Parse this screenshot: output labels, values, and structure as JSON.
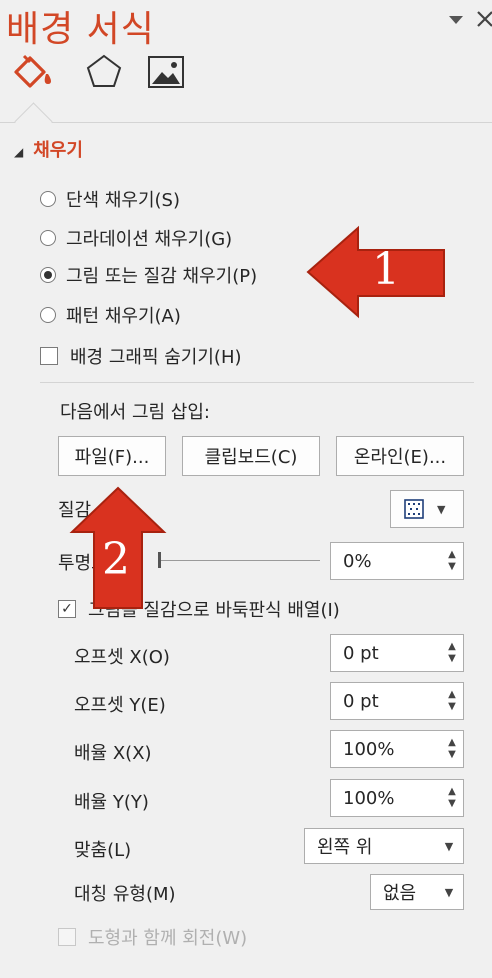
{
  "pane": {
    "title": "배경 서식",
    "options_icon": "pane-options-chevron",
    "close_icon": "close-x",
    "tabs": [
      {
        "icon": "paint-bucket-icon",
        "selected": true
      },
      {
        "icon": "pentagon-icon",
        "selected": false
      },
      {
        "icon": "picture-icon",
        "selected": false
      }
    ]
  },
  "fill": {
    "header": "채우기",
    "options": {
      "solid": "단색 채우기(S)",
      "gradient": "그라데이션 채우기(G)",
      "picture": "그림 또는 질감 채우기(P)",
      "pattern": "패턴 채우기(A)"
    },
    "selected": "picture",
    "hide_bg": "배경 그래픽 숨기기(H)",
    "insert_from": "다음에서 그림 삽입:",
    "buttons": {
      "file": "파일(F)...",
      "clipboard": "클립보드(C)",
      "online": "온라인(E)..."
    },
    "texture_label": "질감",
    "transparency_label": "투명도",
    "transparency_value": "0%",
    "tile_label": "그림을 질감으로 바둑판식 배열(I)",
    "tile_checked": true,
    "offset_x_label": "오프셋 X(O)",
    "offset_x_value": "0 pt",
    "offset_y_label": "오프셋 Y(E)",
    "offset_y_value": "0 pt",
    "scale_x_label": "배율 X(X)",
    "scale_x_value": "100%",
    "scale_y_label": "배율 Y(Y)",
    "scale_y_value": "100%",
    "align_label": "맞춤(L)",
    "align_value": "왼쪽 위",
    "mirror_label": "대칭 유형(M)",
    "mirror_value": "없음",
    "rotate_label": "도형과 함께 회전(W)"
  },
  "annotations": {
    "arrow1_number": "1",
    "arrow2_number": "2",
    "arrow_color": "#d9321f"
  },
  "colors": {
    "accent": "#d24726",
    "pane_bg": "#f0f0f0"
  }
}
